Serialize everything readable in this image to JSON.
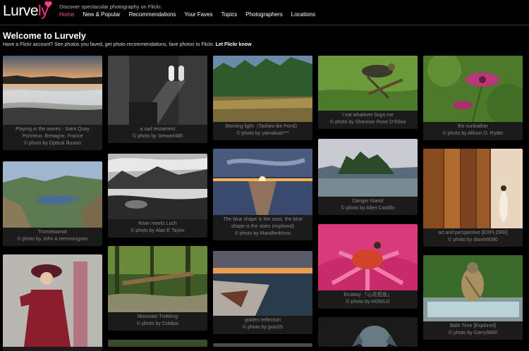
{
  "header": {
    "logo_main": "Lurve",
    "logo_accent": "ly",
    "tagline": "Discover spectacular photography on Flickr.",
    "nav": [
      "Home",
      "New & Popular",
      "Recommendations",
      "Your Faves",
      "Topics",
      "Photographers",
      "Locations"
    ],
    "active_nav": "Home"
  },
  "welcome": {
    "title": "Welcome to Lurvely",
    "subtitle": "Have a Flickr account? See photos you faved, get photo recommendations, fave photos to Flickr.",
    "link": "Let Flickr know"
  },
  "photos": [
    {
      "title": "Playing in the waves - Saint Quay Portrieux, Bretagne, France",
      "credit": "© photo by Optical Illusion"
    },
    {
      "title": "Tromeloamat",
      "credit": "© photo by John A Hemmingsen"
    },
    {
      "title": "",
      "credit": ""
    },
    {
      "title": "a sad testament",
      "credit": "© photo by Stewart485"
    },
    {
      "title": "River meets Loch",
      "credit": "© photo by Alan E Taylor"
    },
    {
      "title": "Mountain Trekking",
      "credit": "© photo by Coldpix"
    },
    {
      "title": "Morning light（Tashiro-ike Pond）",
      "credit": "© photo by yamabuki***"
    },
    {
      "title": "The blue shape is the seas, the blue shape is the skies (explored)",
      "credit": "© photo by Mandfenkhosi"
    },
    {
      "title": "golden reflection",
      "credit": "© photo by guio29"
    },
    {
      "title": "I eat whatever bugs me",
      "credit": "© photo by Shannon Rose O'Shea"
    },
    {
      "title": "Danger Island",
      "credit": "© photo by Allen Castillo"
    },
    {
      "title": "Ecstasy 「心花怒放」",
      "credit": "© photo by HOWLD"
    },
    {
      "title": "the sunbather",
      "credit": "© photo by Allison D. Ryder"
    },
    {
      "title": "art and perspective [EXPLORE]",
      "credit": "© photo by diamir8080"
    },
    {
      "title": "Bath Time [Explored]",
      "credit": "© photo by Garry9600"
    }
  ]
}
